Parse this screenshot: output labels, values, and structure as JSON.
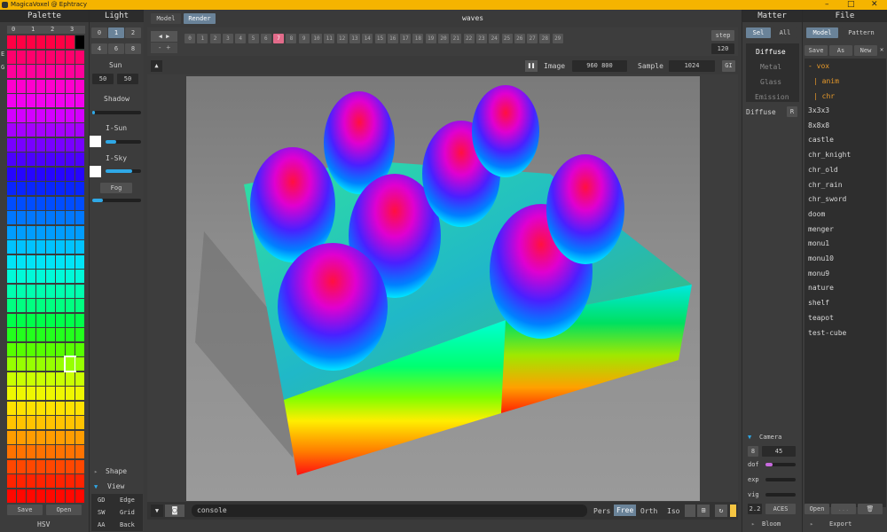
{
  "app": {
    "title": "MagicaVoxel @ Ephtracy",
    "model_name": "waves"
  },
  "window": {
    "minimize": "–",
    "maximize": "□",
    "close": "✕"
  },
  "palette": {
    "title": "Palette",
    "tabs": [
      "0",
      "1",
      "2",
      "3"
    ],
    "side_labels": [
      "E",
      "G"
    ],
    "save": "Save",
    "open": "Open",
    "hsv": "HSV",
    "colors": [
      "#ff0044",
      "#ff0080",
      "#ff00cc",
      "#ee00ff",
      "#aa00ff",
      "#6600ff",
      "#2a00ff",
      "#0030ff",
      "#0070ff",
      "#00a8ff",
      "#00e0ff",
      "#00ffd0",
      "#00ff90",
      "#00ff40",
      "#40ff00",
      "#a0ff00",
      "#e8ff00",
      "#ffe000",
      "#ffb000",
      "#ff7000",
      "#ff3000",
      "#ff0800"
    ]
  },
  "light": {
    "title": "Light",
    "presets": [
      "0",
      "1",
      "2",
      "4",
      "6",
      "8"
    ],
    "sun_label": "Sun",
    "sun_values": [
      "50",
      "50"
    ],
    "shadow_label": "Shadow",
    "i_sun_label": "I-Sun",
    "i_sky_label": "I-Sky",
    "fog_label": "Fog",
    "shape_label": "Shape",
    "view_label": "View",
    "view_rows": [
      [
        "GD",
        "Edge"
      ],
      [
        "SW",
        "Grid"
      ],
      [
        "AA",
        "Back"
      ]
    ]
  },
  "toolbar": {
    "mode_tabs": [
      "Model",
      "Render"
    ],
    "frames": [
      "0",
      "1",
      "2",
      "3",
      "4",
      "5",
      "6",
      "7",
      "8",
      "9",
      "10",
      "11",
      "12",
      "13",
      "14",
      "15",
      "16",
      "17",
      "18",
      "19",
      "20",
      "21",
      "22",
      "23",
      "24",
      "25",
      "26",
      "27",
      "28",
      "29"
    ],
    "active_frame": "7",
    "step_label": "step",
    "step_value": "120",
    "pause_icon": "pause-icon",
    "image_label": "Image",
    "image_size": "960 800",
    "sample_label": "Sample",
    "sample_value": "1024",
    "gi_label": "GI"
  },
  "console": {
    "text": "console",
    "modes": [
      "Pers",
      "Free",
      "Orth",
      "Iso"
    ],
    "active_mode": "Free"
  },
  "matter": {
    "title": "Matter",
    "tabs": [
      "Sel",
      "All"
    ],
    "types": [
      "Diffuse",
      "Metal",
      "Glass",
      "Emission"
    ],
    "selected": "Diffuse",
    "reset": "R",
    "camera_label": "Camera",
    "camera_rows": [
      [
        "8",
        "45"
      ],
      [
        "dof",
        ""
      ],
      [
        "exp",
        ""
      ],
      [
        "vig",
        ""
      ],
      [
        "2.2",
        "ACES"
      ]
    ],
    "bloom_label": "Bloom"
  },
  "file": {
    "title": "File",
    "tabs": [
      "Model",
      "Pattern"
    ],
    "actions": [
      "Save",
      "As",
      "New"
    ],
    "tree": [
      "- vox",
      "| anim",
      "| chr"
    ],
    "items": [
      "3x3x3",
      "8x8x8",
      "castle",
      "chr_knight",
      "chr_old",
      "chr_rain",
      "chr_sword",
      "doom",
      "menger",
      "monu1",
      "monu10",
      "monu9",
      "nature",
      "shelf",
      "teapot",
      "test-cube"
    ],
    "open": "Open",
    "more": "...",
    "export_label": "Export"
  },
  "accent": "#f5b400"
}
